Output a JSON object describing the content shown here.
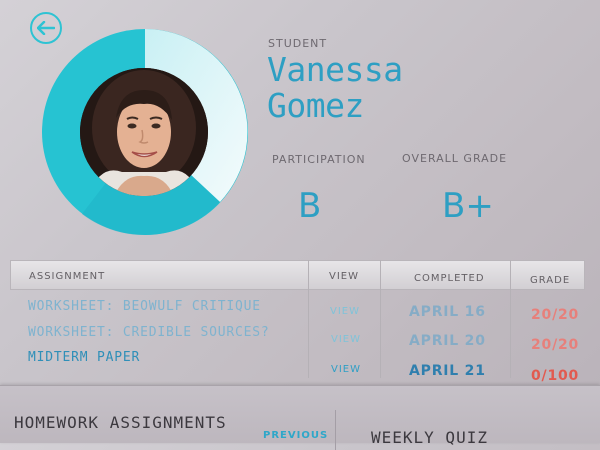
{
  "nav": {
    "back_icon": "back-arrow-icon"
  },
  "student": {
    "label": "STUDENT",
    "first_name": "Vanessa",
    "last_name": "Gomez",
    "participation_progress": 0.8
  },
  "grades": {
    "participation_label": "PARTICIPATION",
    "participation_value": "B",
    "overall_label": "OVERALL GRADE",
    "overall_value": "B+"
  },
  "table": {
    "headers": {
      "assignment": "ASSIGNMENT",
      "view": "VIEW",
      "completed": "COMPLETED",
      "grade": "GRADE"
    },
    "rows": [
      {
        "assignment": "WORKSHEET: BEOWULF CRITIQUE",
        "view": "VIEW",
        "completed": "APRIL 16",
        "grade": "20/20"
      },
      {
        "assignment": "WORKSHEET: CREDIBLE SOURCES?",
        "view": "VIEW",
        "completed": "APRIL 20",
        "grade": "20/20"
      },
      {
        "assignment": "MIDTERM PAPER",
        "view": "VIEW",
        "completed": "APRIL 21",
        "grade": "0/100"
      }
    ]
  },
  "bottom": {
    "homework_title": "HOMEWORK ASSIGNMENTS",
    "previous_label": "PREVIOUS",
    "weekly_title": "WEEKLY QUIZ"
  },
  "colors": {
    "accent": "#2ec3d3",
    "accent_dark": "#2e9fc3",
    "grade_red": "#e25a4f"
  }
}
